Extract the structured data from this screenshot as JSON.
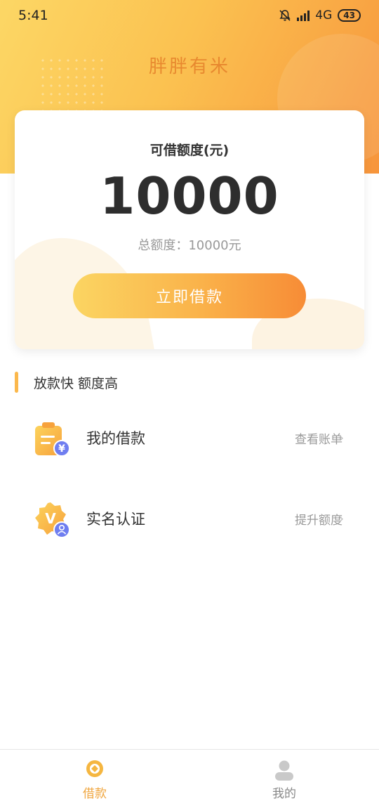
{
  "status_bar": {
    "time": "5:41",
    "network": "4G",
    "battery": "43"
  },
  "app_title": "胖胖有米",
  "card": {
    "label": "可借额度(元)",
    "amount": "10000",
    "total": "总额度：10000元",
    "button_label": "立即借款"
  },
  "section_title": "放款快 额度高",
  "menu": [
    {
      "title": "我的借款",
      "action": "查看账单",
      "icon": "loan-bill-icon"
    },
    {
      "title": "实名认证",
      "action": "提升额度",
      "icon": "verify-badge-icon"
    }
  ],
  "tabbar": {
    "items": [
      {
        "label": "借款",
        "active": true
      },
      {
        "label": "我的",
        "active": false
      }
    ]
  },
  "colors": {
    "accent": "#f7953c",
    "accent_light": "#fcd765",
    "title_orange": "#e8892f",
    "tab_active": "#f0a63f",
    "tab_inactive": "#888888"
  }
}
